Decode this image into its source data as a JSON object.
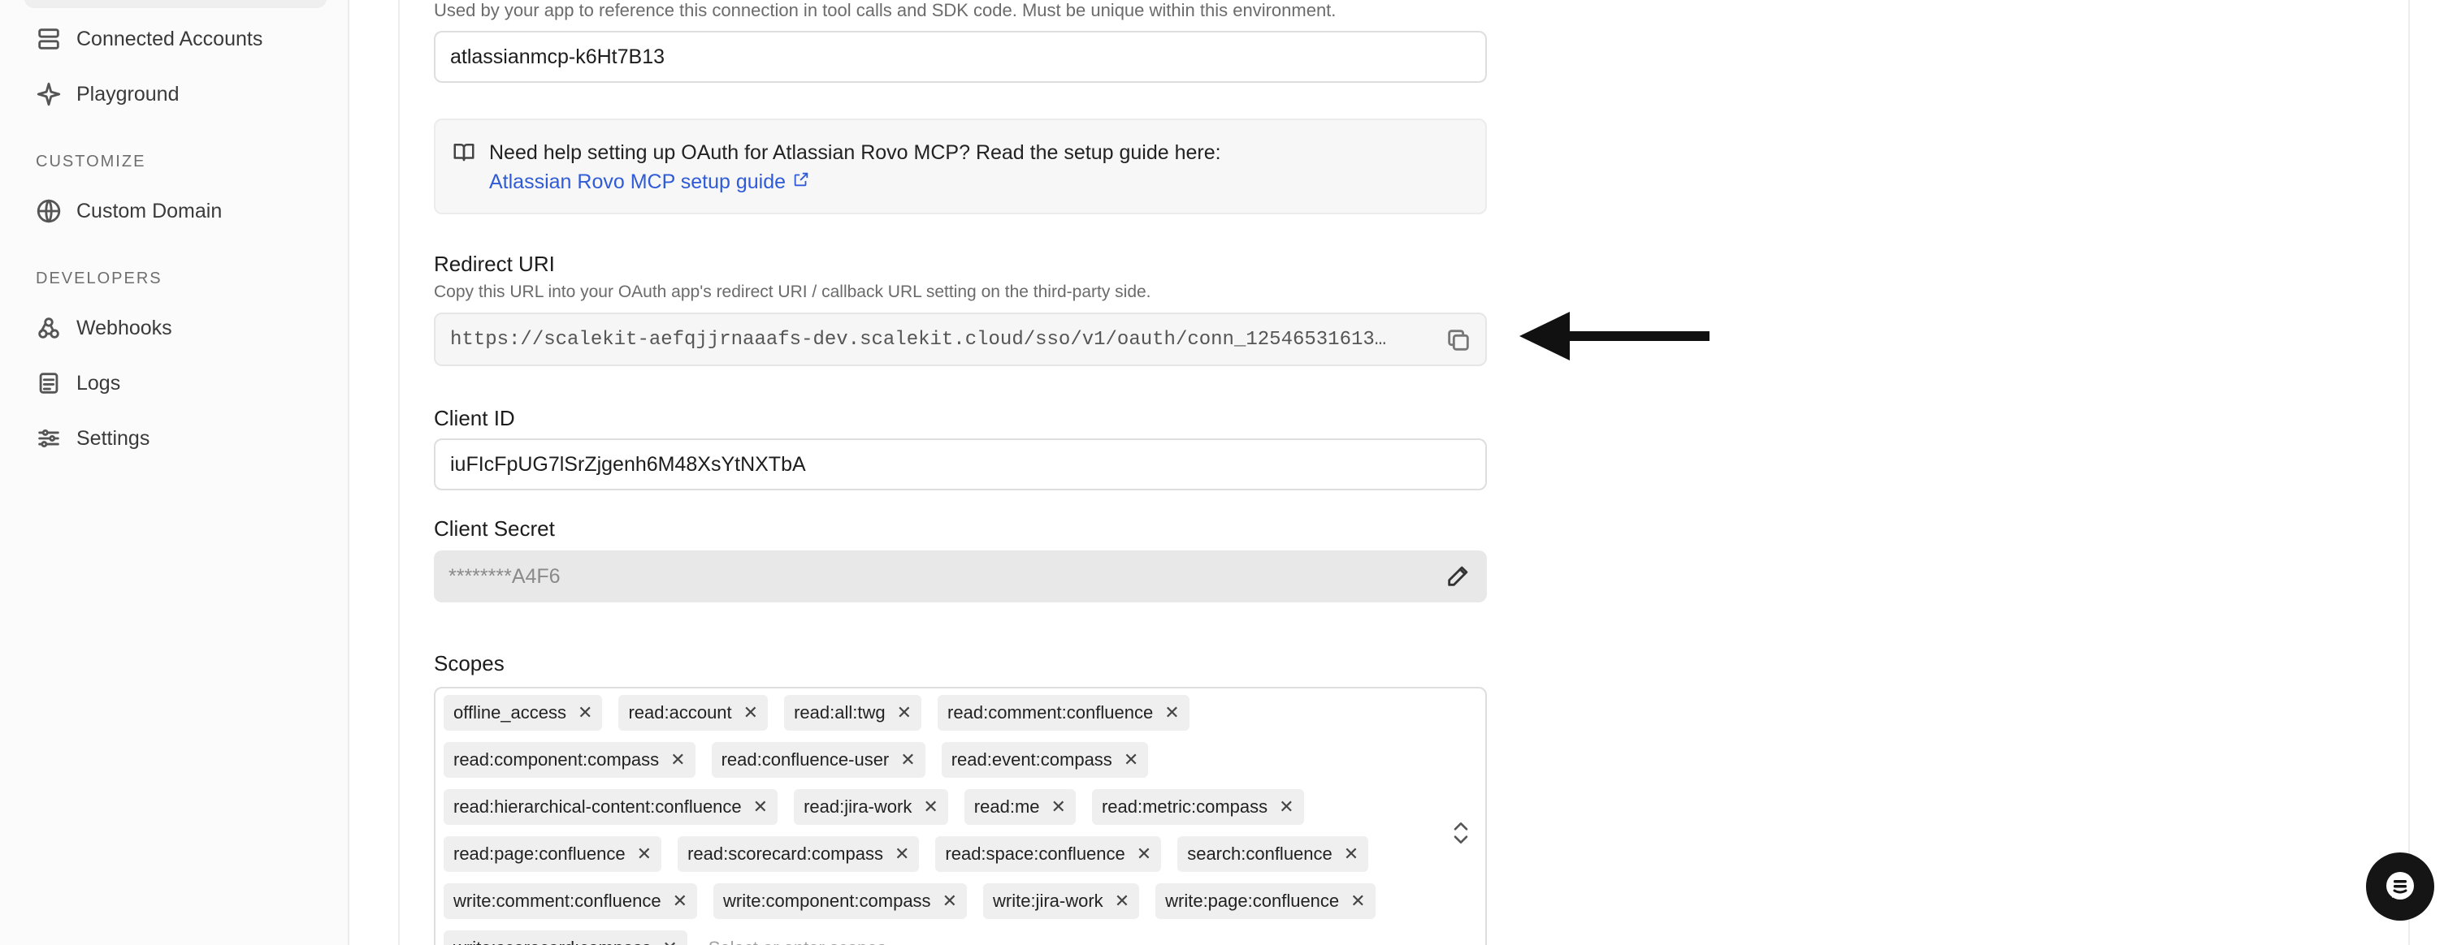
{
  "sidebar": {
    "items_top": [
      {
        "label": "Connected Accounts",
        "icon": "layers-icon"
      },
      {
        "label": "Playground",
        "icon": "sparkle-icon"
      }
    ],
    "section_customize": "CUSTOMIZE",
    "customize_items": [
      {
        "label": "Custom Domain",
        "icon": "globe-icon"
      }
    ],
    "section_developers": "DEVELOPERS",
    "developer_items": [
      {
        "label": "Webhooks",
        "icon": "webhook-icon"
      },
      {
        "label": "Logs",
        "icon": "logs-icon"
      },
      {
        "label": "Settings",
        "icon": "sliders-icon"
      }
    ]
  },
  "form": {
    "identifier_help": "Used by your app to reference this connection in tool calls and SDK code. Must be unique within this environment.",
    "identifier_value": "atlassianmcp-k6Ht7B13",
    "callout": {
      "text": "Need help setting up OAuth for Atlassian Rovo MCP? Read the setup guide here:",
      "link": "Atlassian Rovo MCP setup guide"
    },
    "redirect": {
      "label": "Redirect URI",
      "help": "Copy this URL into your OAuth app's redirect URI / callback URL setting on the third-party side.",
      "value": "https://scalekit-aefqjjrnaaafs-dev.scalekit.cloud/sso/v1/oauth/conn_12546531613…"
    },
    "client_id": {
      "label": "Client ID",
      "value": "iuFIcFpUG7lSrZjgenh6M48XsYtNXTbA"
    },
    "client_secret": {
      "label": "Client Secret",
      "value": "********A4F6"
    },
    "scopes": {
      "label": "Scopes",
      "chips": [
        "offline_access",
        "read:account",
        "read:all:twg",
        "read:comment:confluence",
        "read:component:compass",
        "read:confluence-user",
        "read:event:compass",
        "read:hierarchical-content:confluence",
        "read:jira-work",
        "read:me",
        "read:metric:compass",
        "read:page:confluence",
        "read:scorecard:compass",
        "read:space:confluence",
        "search:confluence",
        "write:comment:confluence",
        "write:component:compass",
        "write:jira-work",
        "write:page:confluence",
        "write:scorecard:compass"
      ],
      "remove_glyph": "✕",
      "placeholder": "Select or enter scopes"
    }
  }
}
